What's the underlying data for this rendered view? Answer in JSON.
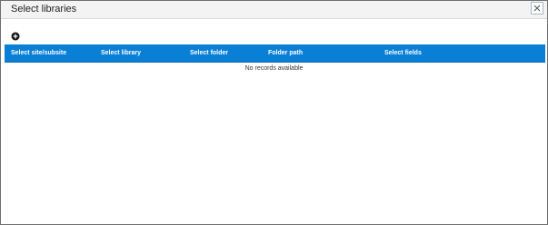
{
  "dialog": {
    "title": "Select libraries",
    "close_icon": "close-icon",
    "add_icon": "add-circle-icon"
  },
  "grid": {
    "columns": [
      "Select site/subsite",
      "Select library",
      "Select folder",
      "Folder path",
      "Select fields"
    ],
    "empty_message": "No records available"
  },
  "colors": {
    "header_bg": "#0a7fd6",
    "header_text": "#ffffff",
    "titlebar_bg": "#f3f3f3"
  }
}
